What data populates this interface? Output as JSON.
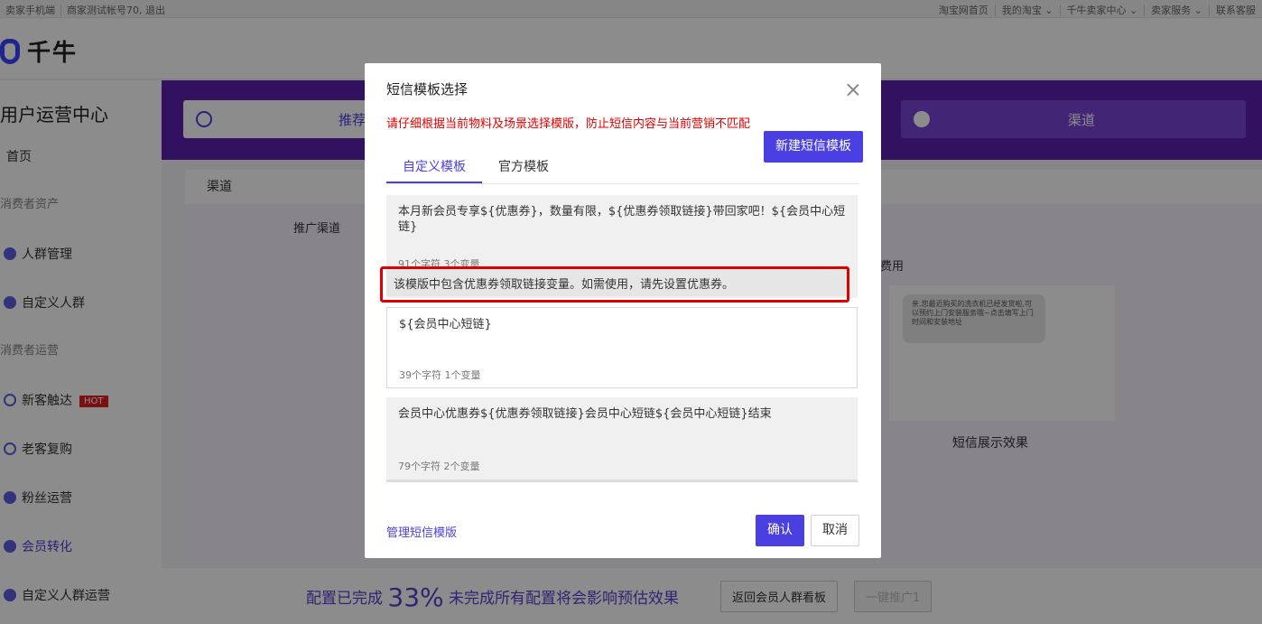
{
  "topbar": {
    "left": [
      "卖家手机端",
      "商家测试帐号70, 退出"
    ],
    "right": [
      "淘宝网首页",
      "我的淘宝 ⌄",
      "千牛卖家中心 ⌄",
      "卖家服务 ⌄",
      "联系客服"
    ]
  },
  "logo": "千牛",
  "sidebar": {
    "title": "用户运营中心",
    "home": "首页",
    "group1": "消费者资产",
    "items1": [
      "人群管理",
      "自定义人群"
    ],
    "group2": "消费者运营",
    "items2": [
      "新客触达",
      "老客复购",
      "粉丝运营",
      "会员转化",
      "自定义人群运营"
    ],
    "hot": "HOT"
  },
  "steps": {
    "recommend": "推荐",
    "channel": "渠道"
  },
  "main": {
    "section_label": "渠道",
    "col_label": "推广渠道",
    "cost_label": "费用",
    "preview_text": "亲,您最近购买的洗衣机已经发货啦,可以预约上门安装服务哦~点击填写上门时间和安装地址",
    "preview_caption": "短信展示效果"
  },
  "bottombar": {
    "msg_prefix": "配置已完成",
    "pct": "33%",
    "msg_suffix": "未完成所有配置将会影响预估效果",
    "back_btn": "返回会员人群看板",
    "promo_btn": "一键推广1"
  },
  "modal": {
    "title": "短信模板选择",
    "warning": "请仔细根据当前物料及场景选择模版，防止短信内容与当前营销不匹配",
    "new_btn": "新建短信模板",
    "tabs": [
      "自定义模板",
      "官方模板"
    ],
    "templates": [
      {
        "text": "本月新会员专享${优惠券}，数量有限，${优惠券领取链接}带回家吧！${会员中心短链}",
        "meta": "91个字符  3个变量"
      },
      {
        "text": "${会员中心短链}",
        "meta": "39个字符  1个变量"
      },
      {
        "text": "会员中心优惠券${优惠券领取链接}会员中心短链${会员中心短链}结束",
        "meta": "79个字符  2个变量"
      }
    ],
    "tip": "该模版中包含优惠券领取链接变量。如需使用，请先设置优惠券。",
    "manage": "管理短信模版",
    "ok": "确认",
    "cancel": "取消"
  }
}
